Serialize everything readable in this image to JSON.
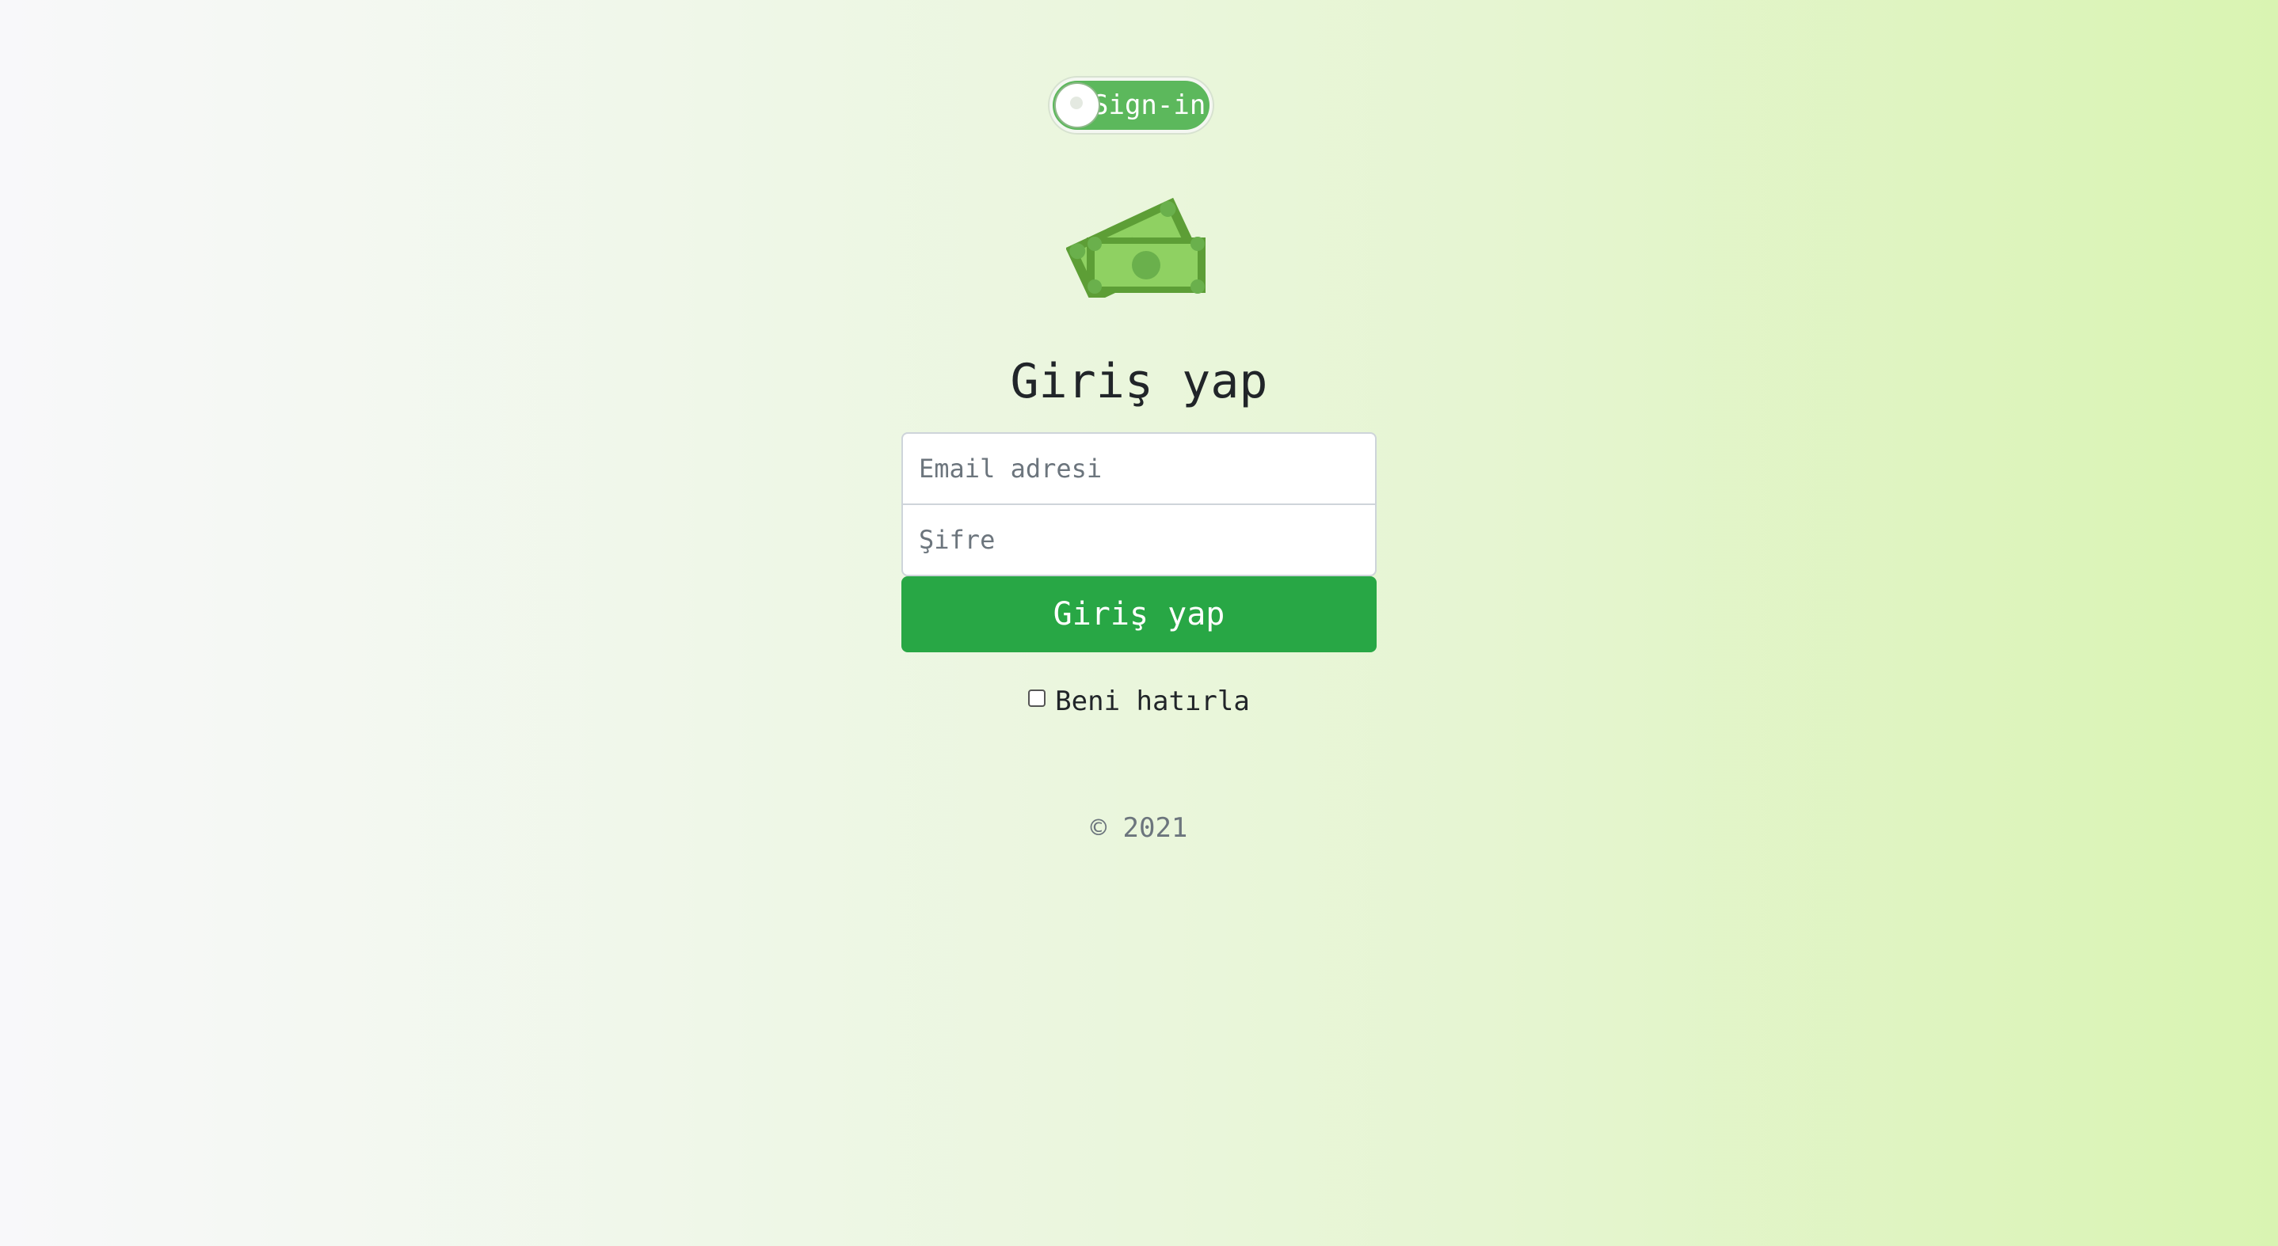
{
  "toggle": {
    "label": "Sign-in",
    "state": "on",
    "color": "#5cb85c"
  },
  "logo": {
    "icon": "money-bills-icon",
    "color": "#6ab04c"
  },
  "heading": "Giriş yap",
  "form": {
    "email": {
      "value": "",
      "placeholder": "Email adresi"
    },
    "password": {
      "value": "",
      "placeholder": "Şifre"
    },
    "submit_label": "Giriş yap",
    "submit_color": "#28a745",
    "remember": {
      "label": "Beni hatırla",
      "checked": false
    }
  },
  "footer": "© 2021"
}
